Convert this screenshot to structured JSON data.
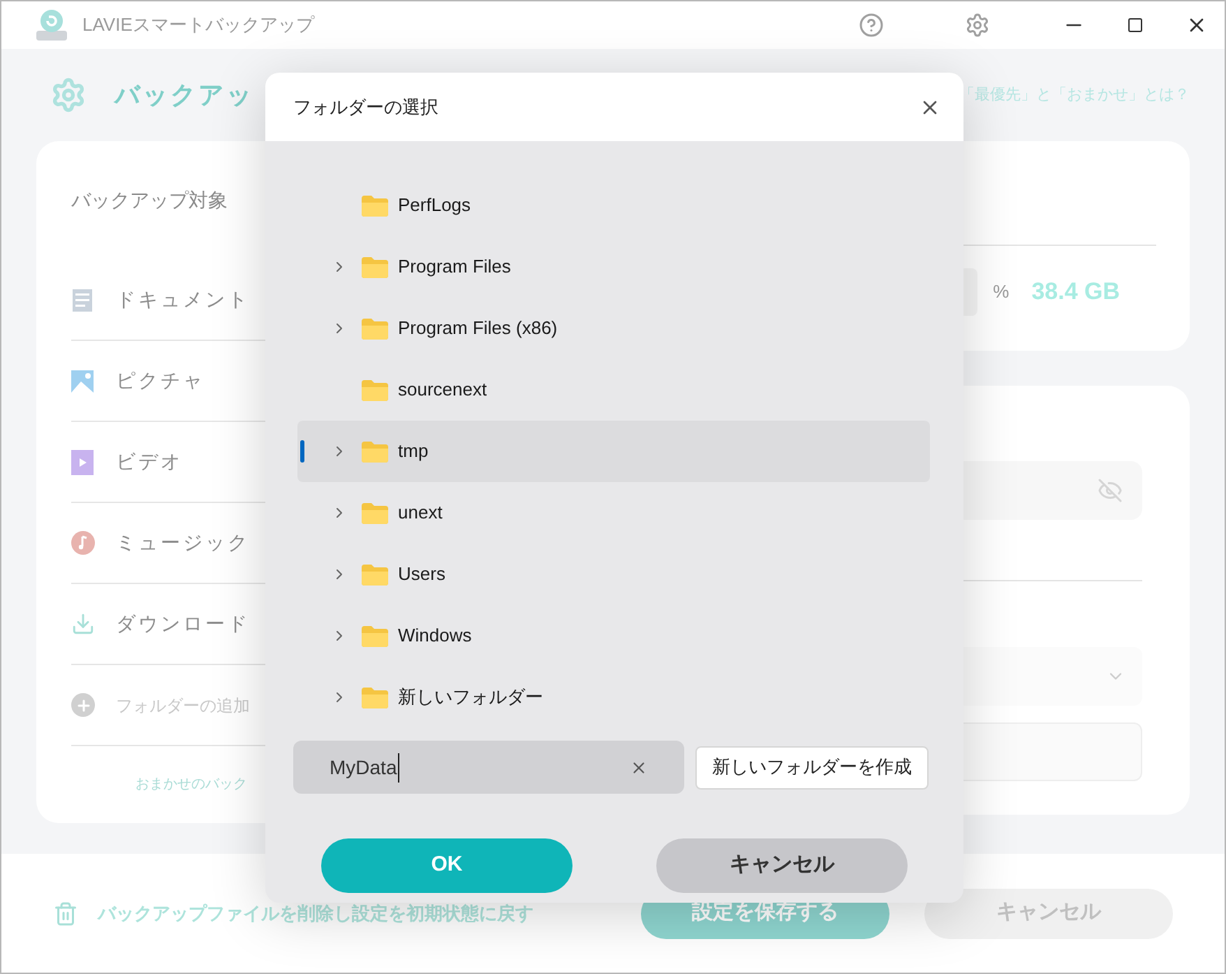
{
  "window": {
    "title": "LAVIEスマートバックアップ"
  },
  "header": {
    "title": "バックアッ",
    "help_link": "「最優先」と「おまかせ」とは？"
  },
  "targets": {
    "heading": "バックアップ対象",
    "items": [
      {
        "label": "ドキュメント",
        "kind": "document"
      },
      {
        "label": "ピクチャ",
        "kind": "picture"
      },
      {
        "label": "ビデオ",
        "kind": "video"
      },
      {
        "label": "ミュージック",
        "kind": "music"
      },
      {
        "label": "ダウンロード",
        "kind": "download"
      },
      {
        "label": "フォルダーの追加",
        "kind": "add"
      }
    ],
    "footer_link": "おまかせのバック"
  },
  "storage": {
    "unit": "%",
    "size": "38.4 GB"
  },
  "footer": {
    "reset_link": "バックアップファイルを削除し設定を初期状態に戻す",
    "save": "設定を保存する",
    "cancel": "キャンセル"
  },
  "dialog": {
    "title": "フォルダーの選択",
    "folders": [
      {
        "name": "PerfLogs",
        "expandable": false,
        "selected": false
      },
      {
        "name": "Program Files",
        "expandable": true,
        "selected": false
      },
      {
        "name": "Program Files (x86)",
        "expandable": true,
        "selected": false
      },
      {
        "name": "sourcenext",
        "expandable": false,
        "selected": false
      },
      {
        "name": "tmp",
        "expandable": true,
        "selected": true
      },
      {
        "name": "unext",
        "expandable": true,
        "selected": false
      },
      {
        "name": "Users",
        "expandable": true,
        "selected": false
      },
      {
        "name": "Windows",
        "expandable": true,
        "selected": false
      },
      {
        "name": "新しいフォルダー",
        "expandable": true,
        "selected": false
      }
    ],
    "name_field": {
      "value": "MyData"
    },
    "create_button": "新しいフォルダーを作成",
    "ok": "OK",
    "cancel": "キャンセル"
  }
}
